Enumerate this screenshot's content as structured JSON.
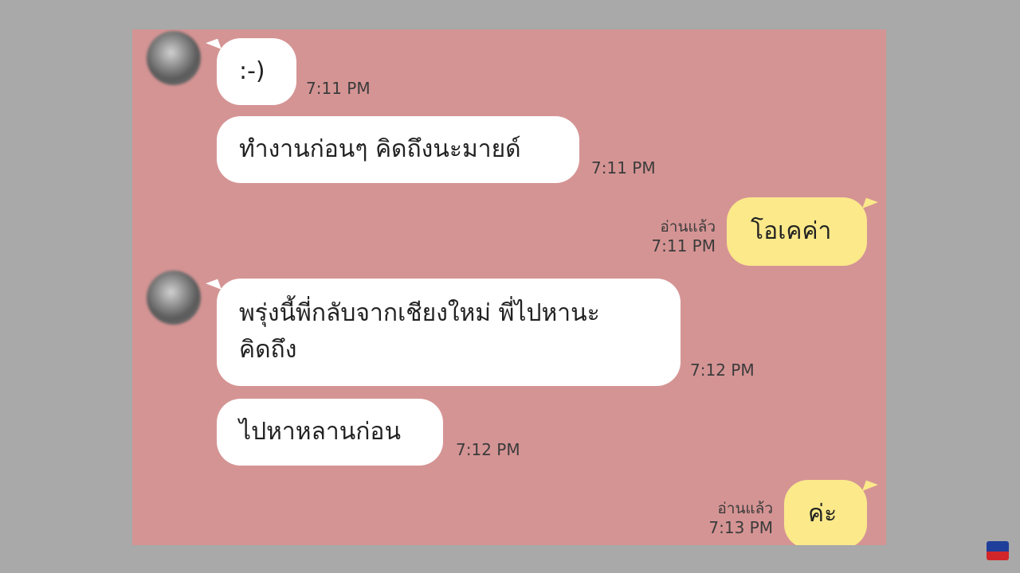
{
  "messages": [
    {
      "id": "m1",
      "direction": "incoming",
      "text": ":-)",
      "time": "7:11 PM"
    },
    {
      "id": "m2",
      "direction": "incoming",
      "text": "ทำงานก่อนๆ คิดถึงนะมายด์",
      "time": "7:11 PM"
    },
    {
      "id": "m3",
      "direction": "outgoing",
      "text": "โอเคค่า",
      "read": "อ่านแล้ว",
      "time": "7:11 PM"
    },
    {
      "id": "m4",
      "direction": "incoming",
      "lines": [
        "พรุ่งนี้พี่กลับจากเชียงใหม่ พี่ไปหานะ",
        "คิดถึง"
      ],
      "time": "7:12 PM"
    },
    {
      "id": "m5",
      "direction": "incoming",
      "text": "ไปหาหลานก่อน",
      "time": "7:12 PM"
    },
    {
      "id": "m6",
      "direction": "outgoing",
      "text": "ค่ะ",
      "read": "อ่านแล้ว",
      "time": "7:13 PM"
    }
  ],
  "colors": {
    "background": "#a8a9a8",
    "chat_background": "#d59494",
    "incoming_bubble": "#ffffff",
    "outgoing_bubble": "#fbe98a"
  },
  "icons": {
    "avatar": "avatar-icon",
    "channel_logo": "channel-logo-icon"
  }
}
